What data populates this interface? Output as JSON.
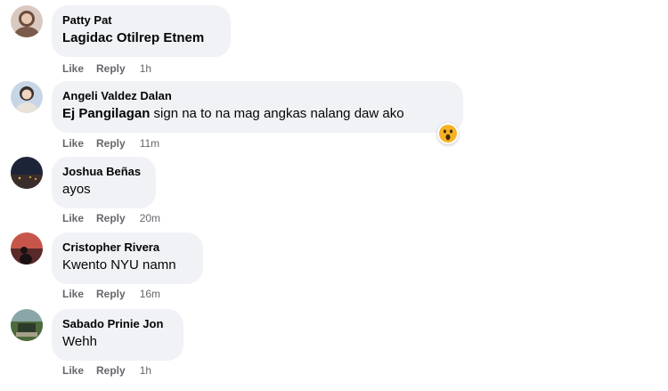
{
  "comments": [
    {
      "author": "Patty Pat",
      "mention": "",
      "text": "Lagidac Otilrep Etnem",
      "like": "Like",
      "reply": "Reply",
      "time": "1h",
      "avatar_color": "#6b4a3a"
    },
    {
      "author": "Angeli Valdez Dalan",
      "mention": "Ej Pangilagan",
      "text": " sign na to na mag angkas nalang daw ako",
      "like": "Like",
      "reply": "Reply",
      "time": "11m",
      "reaction": "wow-emoji",
      "avatar_color": "#8fa9c6"
    },
    {
      "author": "Joshua Beñas",
      "mention": "",
      "text": "ayos",
      "like": "Like",
      "reply": "Reply",
      "time": "20m",
      "avatar_color": "#1c2438"
    },
    {
      "author": "Cristopher Rivera",
      "mention": "",
      "text": "Kwento NYU namn",
      "like": "Like",
      "reply": "Reply",
      "time": "16m",
      "avatar_color": "#b44a3e"
    },
    {
      "author": "Sabado Prinie Jon",
      "mention": "",
      "text": "Wehh",
      "like": "Like",
      "reply": "Reply",
      "time": "1h",
      "avatar_color": "#4d6a3c"
    }
  ]
}
